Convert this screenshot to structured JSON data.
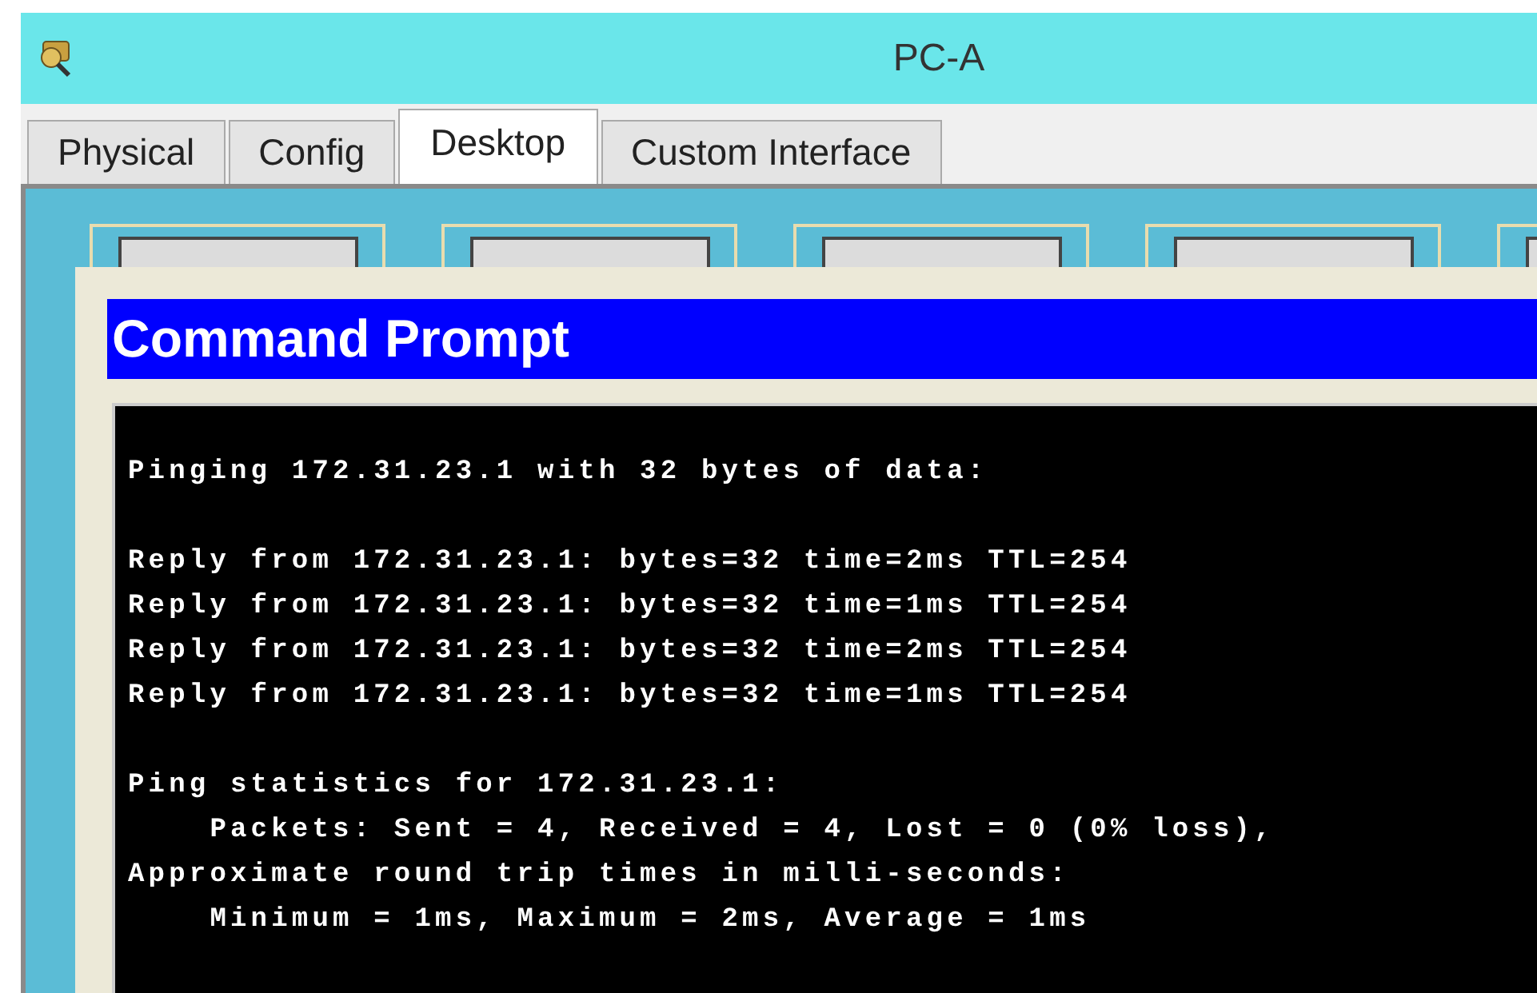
{
  "window": {
    "title": "PC-A"
  },
  "tabs": [
    {
      "label": "Physical",
      "selected": false
    },
    {
      "label": "Config",
      "selected": false
    },
    {
      "label": "Desktop",
      "selected": true
    },
    {
      "label": "Custom Interface",
      "selected": false
    }
  ],
  "command_prompt": {
    "title": "Command Prompt",
    "blocks": [
      [
        "Pinging 172.31.23.1 with 32 bytes of data:"
      ],
      [
        "Reply from 172.31.23.1: bytes=32 time=2ms TTL=254",
        "Reply from 172.31.23.1: bytes=32 time=1ms TTL=254",
        "Reply from 172.31.23.1: bytes=32 time=2ms TTL=254",
        "Reply from 172.31.23.1: bytes=32 time=1ms TTL=254"
      ],
      [
        "Ping statistics for 172.31.23.1:",
        "    Packets: Sent = 4, Received = 4, Lost = 0 (0% loss),",
        "Approximate round trip times in milli-seconds:",
        "    Minimum = 1ms, Maximum = 2ms, Average = 1ms"
      ]
    ]
  }
}
